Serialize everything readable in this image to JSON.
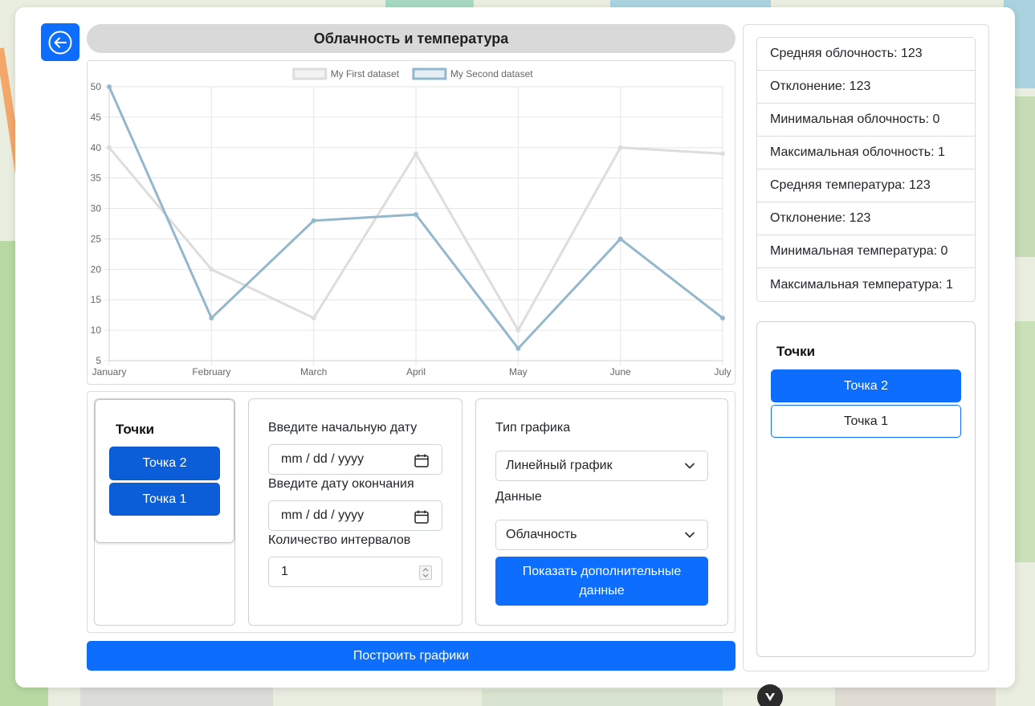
{
  "page": {
    "title": "Облачность и температура",
    "back_icon": "arrow-left-circle-icon"
  },
  "chart_data": {
    "type": "line",
    "categories": [
      "January",
      "February",
      "March",
      "April",
      "May",
      "June",
      "July"
    ],
    "yticks": [
      5,
      10,
      15,
      20,
      25,
      30,
      35,
      40,
      45,
      50
    ],
    "ylim": [
      5,
      50
    ],
    "grid": true,
    "legend_position": "top",
    "series": [
      {
        "name": "My First dataset",
        "values": [
          40,
          20,
          12,
          39,
          10,
          40,
          39
        ],
        "color": "#dddddd"
      },
      {
        "name": "My Second dataset",
        "values": [
          50,
          12,
          28,
          29,
          7,
          25,
          12
        ],
        "color": "#93b8cc"
      }
    ]
  },
  "points_panel": {
    "heading": "Точки",
    "items": [
      "Точка 2",
      "Точка 1"
    ]
  },
  "dates_panel": {
    "start_label": "Введите начальную дату",
    "start_placeholder": "mm / dd / yyyy",
    "end_label": "Введите дату окончания",
    "end_placeholder": "mm / dd / yyyy",
    "intervals_label": "Количество интервалов",
    "intervals_value": "1"
  },
  "type_panel": {
    "chart_type_label": "Тип графика",
    "chart_type_value": "Линейный график",
    "data_label": "Данные",
    "data_value": "Облачность",
    "extra_button": "Показать дополнительные данные"
  },
  "build_button": "Построить графики",
  "stats": [
    "Средняя облочность: 123",
    "Отклонение: 123",
    "Минимальная облочность: 0",
    "Максимальная облочность: 1",
    "Средняя температура: 123",
    "Отклонение: 123",
    "Минимальная температура: 0",
    "Максимальная температура: 1"
  ],
  "right_points": {
    "heading": "Точки",
    "items": [
      "Точка 2",
      "Точка 1"
    ],
    "selected_index": 0
  },
  "colors": {
    "primary": "#0d6efd",
    "primary_dark": "#0b5ed7"
  }
}
